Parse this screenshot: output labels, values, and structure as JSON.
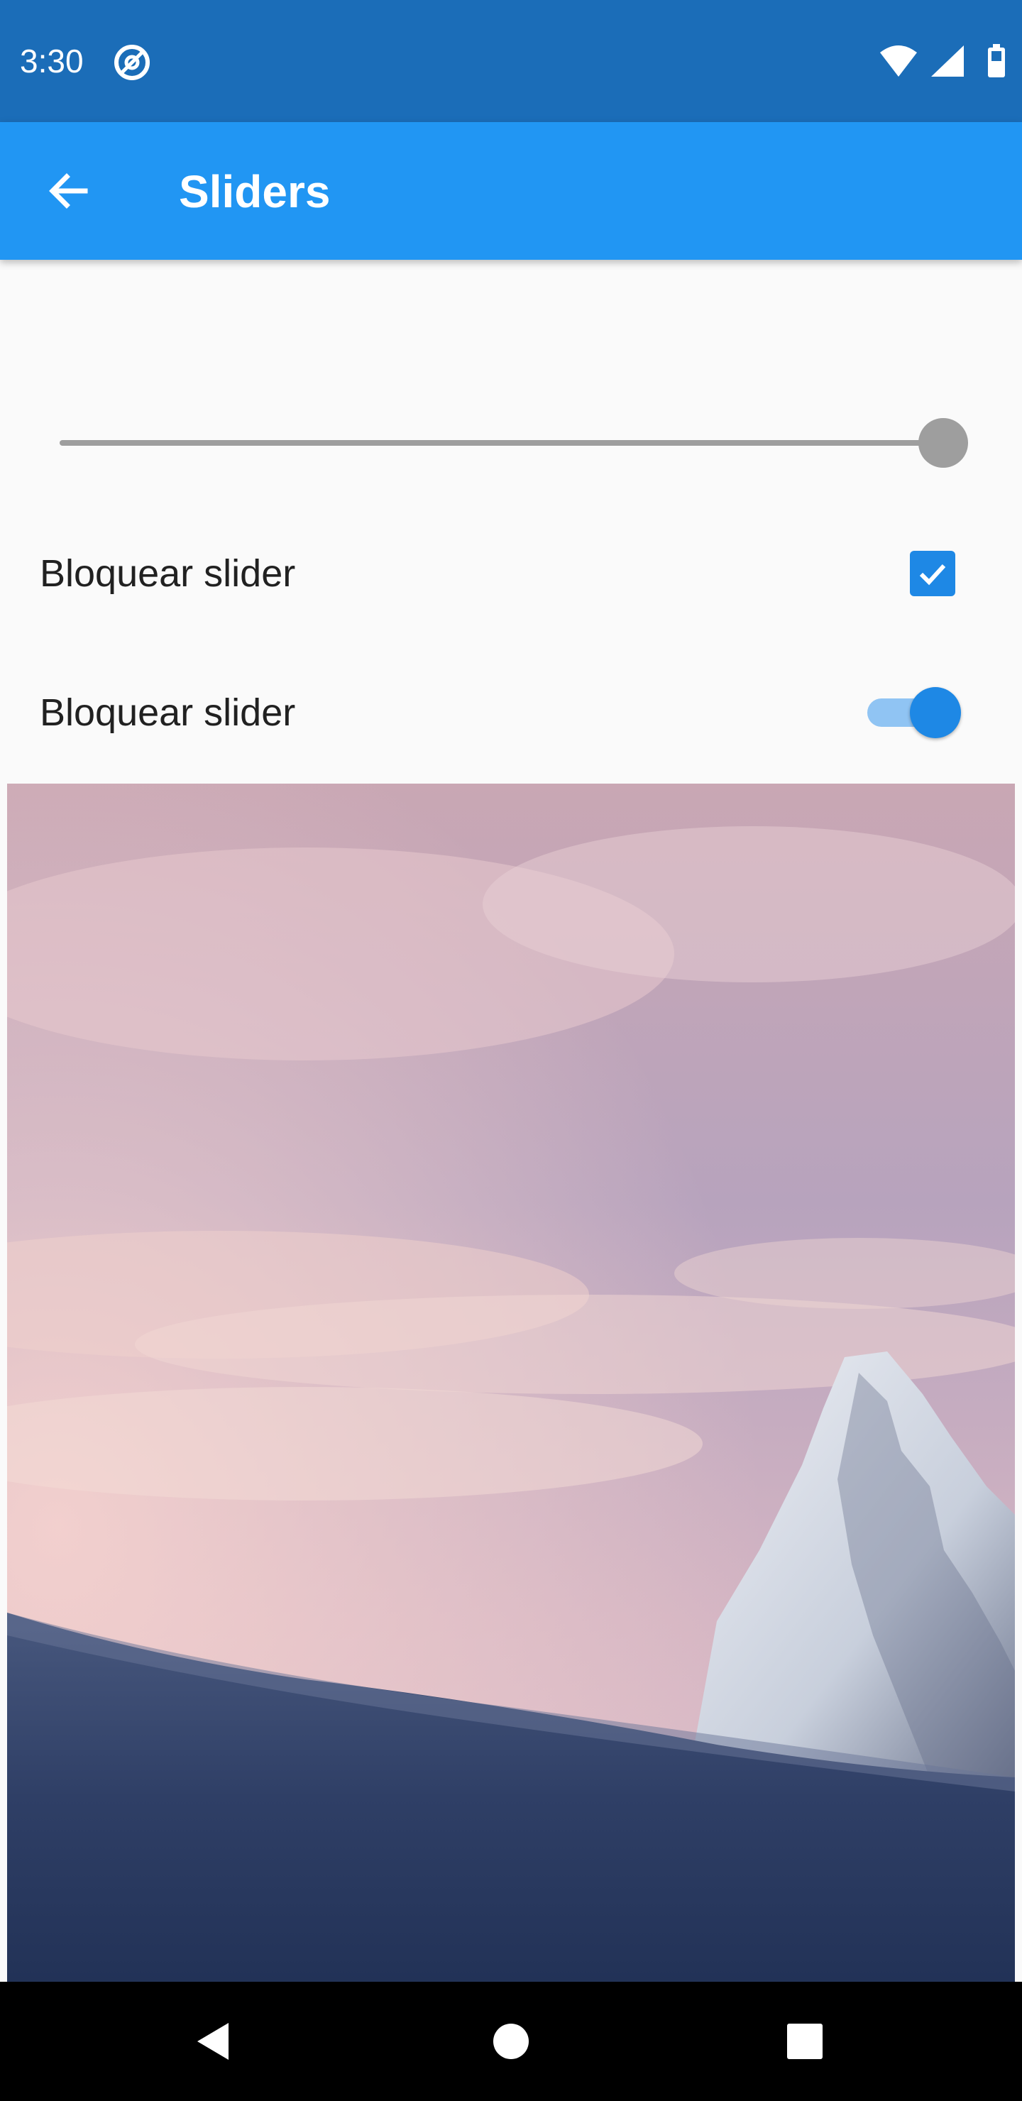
{
  "status_bar": {
    "time": "3:30",
    "icons": [
      "at-sign-icon",
      "wifi-icon",
      "signal-icon",
      "battery-icon"
    ]
  },
  "app_bar": {
    "title": "Sliders",
    "back_icon": "arrow-back-icon",
    "color": "#2196f3"
  },
  "slider": {
    "value_fraction": 1.0,
    "disabled": true,
    "color": "#9e9e9e"
  },
  "options": [
    {
      "label": "Bloquear slider",
      "control": "checkbox",
      "checked": true
    },
    {
      "label": "Bloquear slider",
      "control": "switch",
      "on": true
    }
  ],
  "image": {
    "description_icon": "mountain-landscape-image"
  },
  "nav_bar": {
    "buttons": [
      "back-triangle-icon",
      "home-circle-icon",
      "recents-square-icon"
    ]
  }
}
